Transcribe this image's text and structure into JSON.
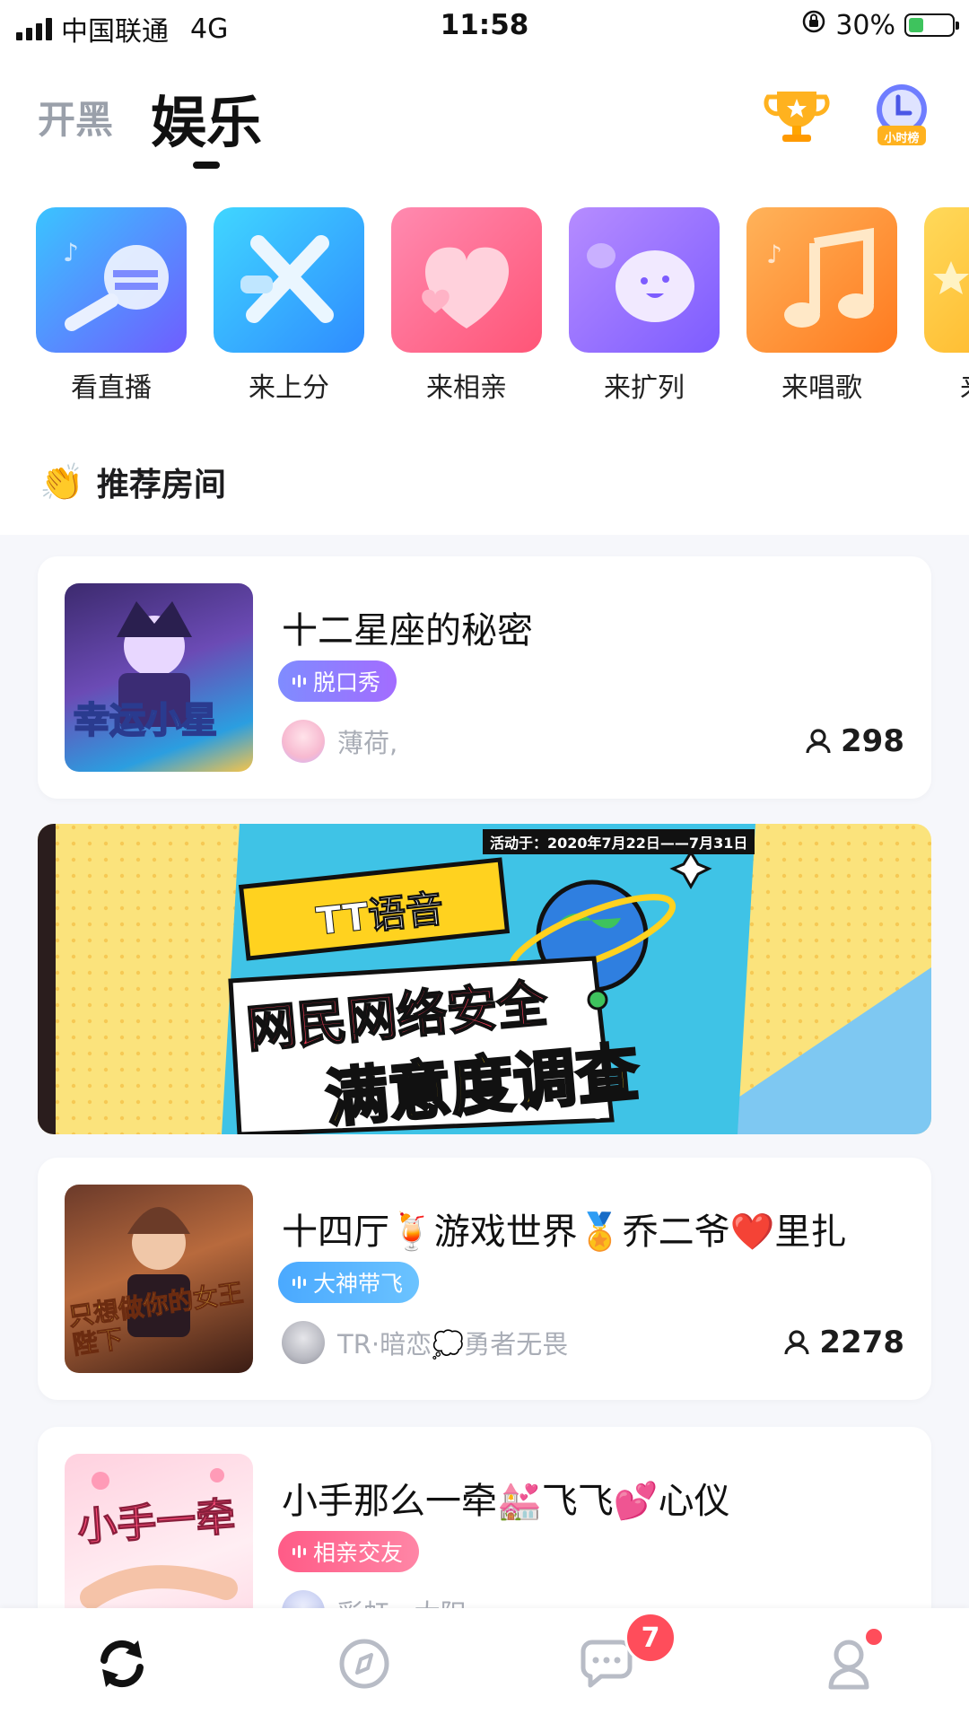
{
  "status_bar": {
    "carrier": "中国联通",
    "network": "4G",
    "time": "11:58",
    "battery": "30%"
  },
  "header": {
    "tab_inactive": "开黑",
    "tab_active": "娱乐",
    "trophy_icon": "trophy-icon",
    "hourly_rank_label": "小时榜"
  },
  "categories": [
    {
      "label": "看直播",
      "icon": "microphone-icon"
    },
    {
      "label": "来上分",
      "icon": "crossed-swords-icon"
    },
    {
      "label": "来相亲",
      "icon": "heart-icon"
    },
    {
      "label": "来扩列",
      "icon": "chat-bubble-icon"
    },
    {
      "label": "来唱歌",
      "icon": "music-note-icon"
    },
    {
      "label": "来",
      "icon": "star-icon"
    }
  ],
  "section_title": "推荐房间",
  "rooms": [
    {
      "title": "十二星座的秘密",
      "tag": "脱口秀",
      "tag_color": "#8b7bff",
      "host": "薄荷,",
      "count": "298",
      "thumb_text": "幸运小星"
    },
    {
      "title": "十四厅🍹游戏世界🏅乔二爷❤️里扎",
      "tag": "大神带飞",
      "tag_color": "#4aa9ff",
      "host": "TR·暗恋💭勇者无畏",
      "count": "2278",
      "thumb_text": "只想做你的女王陛下"
    },
    {
      "title": "小手那么一牵💒飞飞💕心仪",
      "tag": "相亲交友",
      "tag_color": "#ff5b87",
      "host": "彩虹 · 太阳",
      "count": "",
      "thumb_text": "小手一牵"
    }
  ],
  "banner": {
    "date": "活动于：2020年7月22日——7月31日",
    "brand": "TT语音",
    "line1": "网民网络安全",
    "line2": "满意度调查"
  },
  "tabbar": {
    "items": [
      "refresh-icon",
      "compass-icon",
      "message-icon",
      "profile-icon"
    ],
    "message_badge": "7"
  }
}
